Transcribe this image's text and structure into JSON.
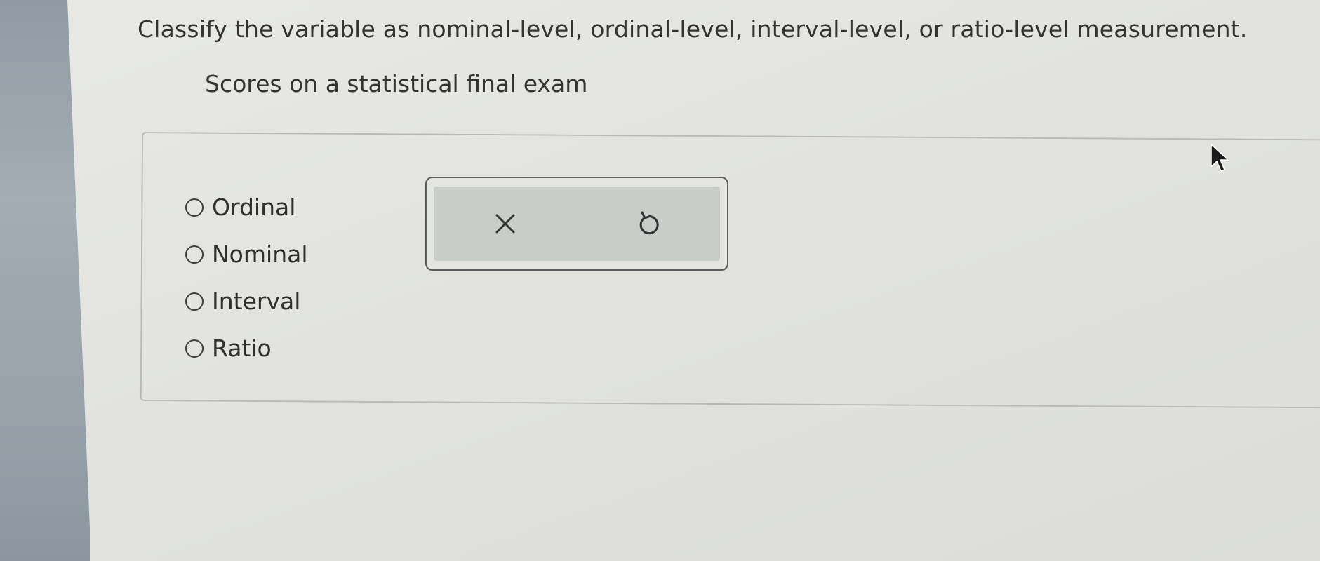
{
  "question": {
    "text": "Classify the variable as nominal-level, ordinal-level, interval-level, or ratio-level measurement."
  },
  "prompt": {
    "text": "Scores on a statistical final exam"
  },
  "options": [
    {
      "label": "Ordinal",
      "selected": false
    },
    {
      "label": "Nominal",
      "selected": false
    },
    {
      "label": "Interval",
      "selected": false
    },
    {
      "label": "Ratio",
      "selected": false
    }
  ],
  "toolbox": {
    "clear_icon": "close-icon",
    "undo_icon": "undo-icon"
  },
  "colors": {
    "text": "#2b2b2b",
    "toolbox_fill": "#c9cdca",
    "toolbox_border": "#5a5c5d"
  }
}
